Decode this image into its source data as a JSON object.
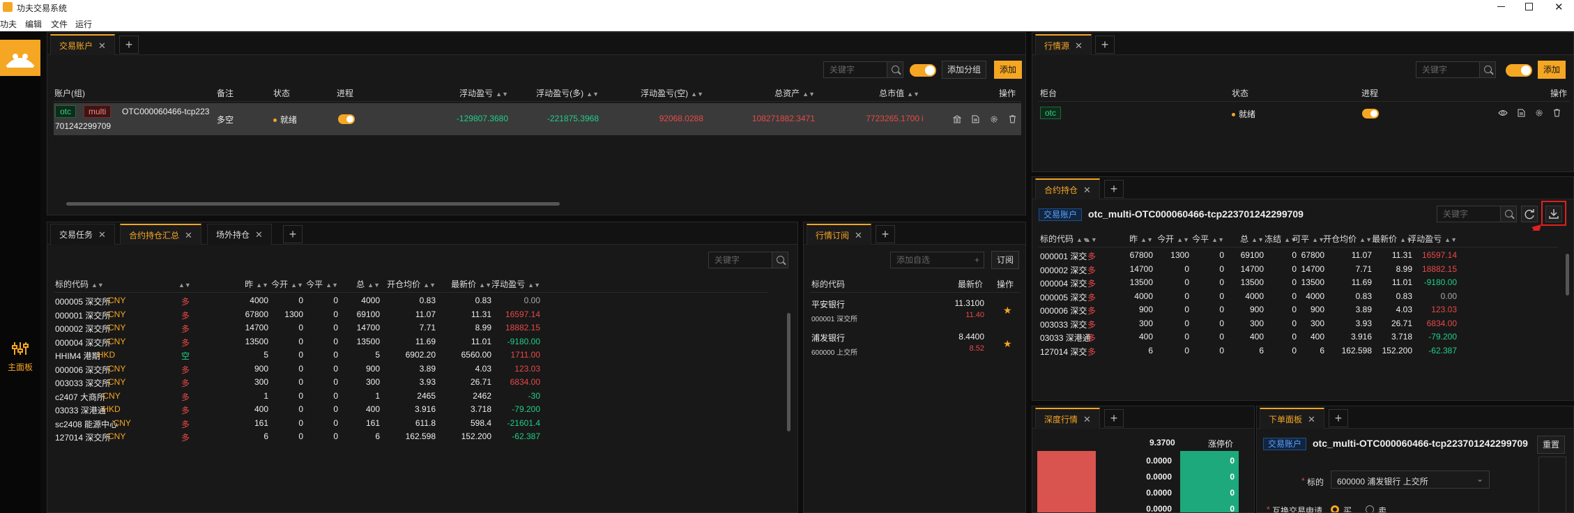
{
  "app": {
    "title": "功夫交易系统",
    "menus": [
      "功夫",
      "编辑",
      "文件",
      "运行"
    ],
    "main_panel_label": "主面板"
  },
  "account_panel": {
    "tab": "交易账户",
    "search_placeholder": "关键字",
    "add_group": "添加分组",
    "add": "添加",
    "headers": [
      "账户(组)",
      "备注",
      "状态",
      "进程",
      "浮动盈亏",
      "浮动盈亏(多)",
      "浮动盈亏(空)",
      "总资产",
      "总市值",
      "操作"
    ],
    "row": {
      "tag1": "otc",
      "tag2": "multi",
      "account": "OTC000060466-tcp223",
      "account2": "701242299709",
      "note": "多空",
      "status": "就绪",
      "pnl": "-129807.3680",
      "pnl_long": "-221875.3968",
      "pnl_short": "92068.0288",
      "total_assets": "108271882.3471",
      "market_value": "7723265.1700",
      "mark": "i"
    }
  },
  "bottom_left": {
    "tabs": [
      "交易任务",
      "合约持仓汇总",
      "场外持仓"
    ],
    "search_placeholder": "关键字",
    "headers": [
      "标的代码",
      "",
      "昨",
      "今开",
      "今平",
      "总",
      "开仓均价",
      "最新价",
      "浮动盈亏"
    ],
    "rows": [
      {
        "code": "000005 深交所",
        "cur": "CNY",
        "dir": "多",
        "y": "4000",
        "to": "0",
        "tc": "0",
        "total": "4000",
        "avg": "0.83",
        "last": "0.83",
        "pnl": "0.00",
        "pc": "muted"
      },
      {
        "code": "000001 深交所",
        "cur": "CNY",
        "dir": "多",
        "y": "67800",
        "to": "1300",
        "tc": "0",
        "total": "69100",
        "avg": "11.07",
        "last": "11.31",
        "pnl": "16597.14",
        "pc": "red"
      },
      {
        "code": "000002 深交所",
        "cur": "CNY",
        "dir": "多",
        "y": "14700",
        "to": "0",
        "tc": "0",
        "total": "14700",
        "avg": "7.71",
        "last": "8.99",
        "pnl": "18882.15",
        "pc": "red"
      },
      {
        "code": "000004 深交所",
        "cur": "CNY",
        "dir": "多",
        "y": "13500",
        "to": "0",
        "tc": "0",
        "total": "13500",
        "avg": "11.69",
        "last": "11.01",
        "pnl": "-9180.00",
        "pc": "green"
      },
      {
        "code": "HHIM4 港期",
        "cur": "HKD",
        "dir": "空",
        "y": "5",
        "to": "0",
        "tc": "0",
        "total": "5",
        "avg": "6902.20",
        "last": "6560.00",
        "pnl": "1711.00",
        "pc": "red"
      },
      {
        "code": "000006 深交所",
        "cur": "CNY",
        "dir": "多",
        "y": "900",
        "to": "0",
        "tc": "0",
        "total": "900",
        "avg": "3.89",
        "last": "4.03",
        "pnl": "123.03",
        "pc": "red"
      },
      {
        "code": "003033 深交所",
        "cur": "CNY",
        "dir": "多",
        "y": "300",
        "to": "0",
        "tc": "0",
        "total": "300",
        "avg": "3.93",
        "last": "26.71",
        "pnl": "6834.00",
        "pc": "red"
      },
      {
        "code": "c2407 大商所",
        "cur": "CNY",
        "dir": "多",
        "y": "1",
        "to": "0",
        "tc": "0",
        "total": "1",
        "avg": "2465",
        "last": "2462",
        "pnl": "-30",
        "pc": "green"
      },
      {
        "code": "03033 深港通",
        "cur": "HKD",
        "dir": "多",
        "y": "400",
        "to": "0",
        "tc": "0",
        "total": "400",
        "avg": "3.916",
        "last": "3.718",
        "pnl": "-79.200",
        "pc": "green"
      },
      {
        "code": "sc2408 能源中心",
        "cur": "CNY",
        "dir": "多",
        "y": "161",
        "to": "0",
        "tc": "0",
        "total": "161",
        "avg": "611.8",
        "last": "598.4",
        "pnl": "-21601.4",
        "pc": "green"
      },
      {
        "code": "127014 深交所",
        "cur": "CNY",
        "dir": "多",
        "y": "6",
        "to": "0",
        "tc": "0",
        "total": "6",
        "avg": "162.598",
        "last": "152.200",
        "pnl": "-62.387",
        "pc": "green"
      }
    ]
  },
  "quote_sub": {
    "tab": "行情订阅",
    "add_placeholder": "添加自选",
    "subscribe": "订阅",
    "headers": [
      "标的代码",
      "最新价",
      "操作"
    ],
    "rows": [
      {
        "name": "平安银行",
        "code": "000001 深交所",
        "price": "11.3100",
        "change": "11.40"
      },
      {
        "name": "浦发银行",
        "code": "600000 上交所",
        "price": "8.4400",
        "change": "8.52"
      }
    ]
  },
  "market_source": {
    "tab": "行情源",
    "search_placeholder": "关键字",
    "add": "添加",
    "headers": [
      "柜台",
      "状态",
      "进程",
      "操作"
    ],
    "row": {
      "counter": "otc",
      "status": "就绪"
    }
  },
  "contract_pos": {
    "tab": "合约持仓",
    "acct_tag": "交易账户",
    "account": "otc_multi-OTC000060466-tcp223701242299709",
    "search_placeholder": "关键字",
    "headers": [
      "标的代码",
      "",
      "昨",
      "今开",
      "今平",
      "总",
      "冻结",
      "可平",
      "开仓均价",
      "最新价",
      "浮动盈亏"
    ],
    "rows": [
      {
        "code": "000001 深交",
        "dir": "多",
        "y": "67800",
        "to": "1300",
        "tc": "0",
        "total": "69100",
        "frz": "0",
        "avail": "67800",
        "avg": "11.07",
        "last": "11.31",
        "pnl": "16597.14",
        "pc": "red"
      },
      {
        "code": "000002 深交",
        "dir": "多",
        "y": "14700",
        "to": "0",
        "tc": "0",
        "total": "14700",
        "frz": "0",
        "avail": "14700",
        "avg": "7.71",
        "last": "8.99",
        "pnl": "18882.15",
        "pc": "red"
      },
      {
        "code": "000004 深交",
        "dir": "多",
        "y": "13500",
        "to": "0",
        "tc": "0",
        "total": "13500",
        "frz": "0",
        "avail": "13500",
        "avg": "11.69",
        "last": "11.01",
        "pnl": "-9180.00",
        "pc": "green"
      },
      {
        "code": "000005 深交",
        "dir": "多",
        "y": "4000",
        "to": "0",
        "tc": "0",
        "total": "4000",
        "frz": "0",
        "avail": "4000",
        "avg": "0.83",
        "last": "0.83",
        "pnl": "0.00",
        "pc": "muted"
      },
      {
        "code": "000006 深交",
        "dir": "多",
        "y": "900",
        "to": "0",
        "tc": "0",
        "total": "900",
        "frz": "0",
        "avail": "900",
        "avg": "3.89",
        "last": "4.03",
        "pnl": "123.03",
        "pc": "red"
      },
      {
        "code": "003033 深交",
        "dir": "多",
        "y": "300",
        "to": "0",
        "tc": "0",
        "total": "300",
        "frz": "0",
        "avail": "300",
        "avg": "3.93",
        "last": "26.71",
        "pnl": "6834.00",
        "pc": "red"
      },
      {
        "code": "03033 深港通",
        "dir": "多",
        "y": "400",
        "to": "0",
        "tc": "0",
        "total": "400",
        "frz": "0",
        "avail": "400",
        "avg": "3.916",
        "last": "3.718",
        "pnl": "-79.200",
        "pc": "green"
      },
      {
        "code": "127014 深交",
        "dir": "多",
        "y": "6",
        "to": "0",
        "tc": "0",
        "total": "6",
        "frz": "0",
        "avail": "6",
        "avg": "162.598",
        "last": "152.200",
        "pnl": "-62.387",
        "pc": "green"
      }
    ]
  },
  "depth": {
    "tab": "深度行情",
    "price": "9.3700",
    "change_label": "涨停价",
    "bids": [
      "0.0000",
      "0.0000",
      "0.0000",
      "0.0000"
    ],
    "vols": [
      "0",
      "0",
      "0",
      "0"
    ]
  },
  "order_panel": {
    "tab": "下单面板",
    "acct_tag": "交易账户",
    "account": "otc_multi-OTC000060466-tcp223701242299709",
    "reset": "重置",
    "instrument_label": "标的",
    "instrument": "600000 浦发银行 上交所",
    "option_label": "互换交易申请",
    "opt1": "买",
    "opt2": "卖",
    "required_mark": "*"
  },
  "colors": {
    "accent": "#f5a623",
    "up": "#e84949",
    "down": "#1fcf8a",
    "highlight_box": "#e02020"
  }
}
